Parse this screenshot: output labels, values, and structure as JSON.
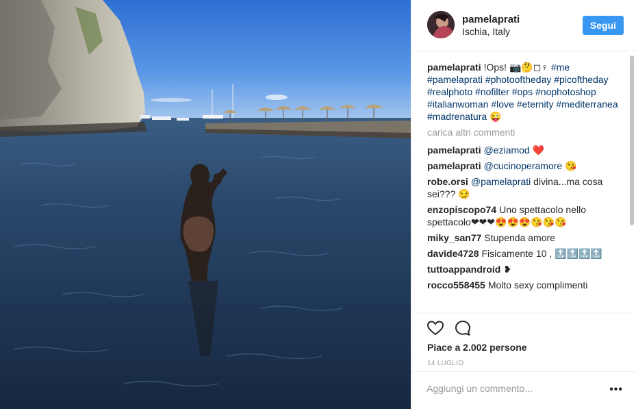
{
  "post": {
    "username": "pamelaprati",
    "location": "Ischia, Italy",
    "follow_label": "Segui",
    "caption": {
      "user": "pamelaprati",
      "text": "!Ops! 📷🤔◻♀",
      "hashtags": "#me #pamelaprati #photooftheday #picoftheday #realphoto #nofilter #ops #nophotoshop #italianwoman #love #eternity #mediterranea #madrenatura",
      "emoji": "😜"
    },
    "load_more": "carica altri commenti",
    "comments": [
      {
        "user": "pamelaprati",
        "mention": "@eziamod",
        "text": "",
        "emoji": "❤️"
      },
      {
        "user": "pamelaprati",
        "mention": "@cucinoperamore",
        "text": "",
        "emoji": "😘"
      },
      {
        "user": "robe.orsi",
        "mention": "@pamelaprati",
        "text": "divina...ma cosa sei???",
        "emoji": "😏"
      },
      {
        "user": "enzopiscopo74",
        "mention": "",
        "text": "Uno spettacolo nello spettacolo❤❤❤",
        "emoji": "😍😍😍😘😘😘"
      },
      {
        "user": "miky_san77",
        "mention": "",
        "text": "Stupenda amore",
        "emoji": ""
      },
      {
        "user": "davide4728",
        "mention": "",
        "text": "Fisicamente 10 ,",
        "emoji": "🔝🔝🔝🔝"
      },
      {
        "user": "tuttoappandroid",
        "mention": "",
        "text": "",
        "emoji": "❥"
      },
      {
        "user": "rocco558455",
        "mention": "",
        "text": "Molto sexy complimenti",
        "emoji": ""
      }
    ],
    "likes_text": "Piace a 2.002 persone",
    "date": "14 LUGLIO",
    "comment_placeholder": "Aggiungi un commento...",
    "more_options": "•••"
  },
  "icons": {
    "like": "heart-outline-icon",
    "comment": "speech-bubble-icon"
  },
  "colors": {
    "follow_button": "#3897f0",
    "hashtag": "#003569",
    "muted": "#999999"
  }
}
